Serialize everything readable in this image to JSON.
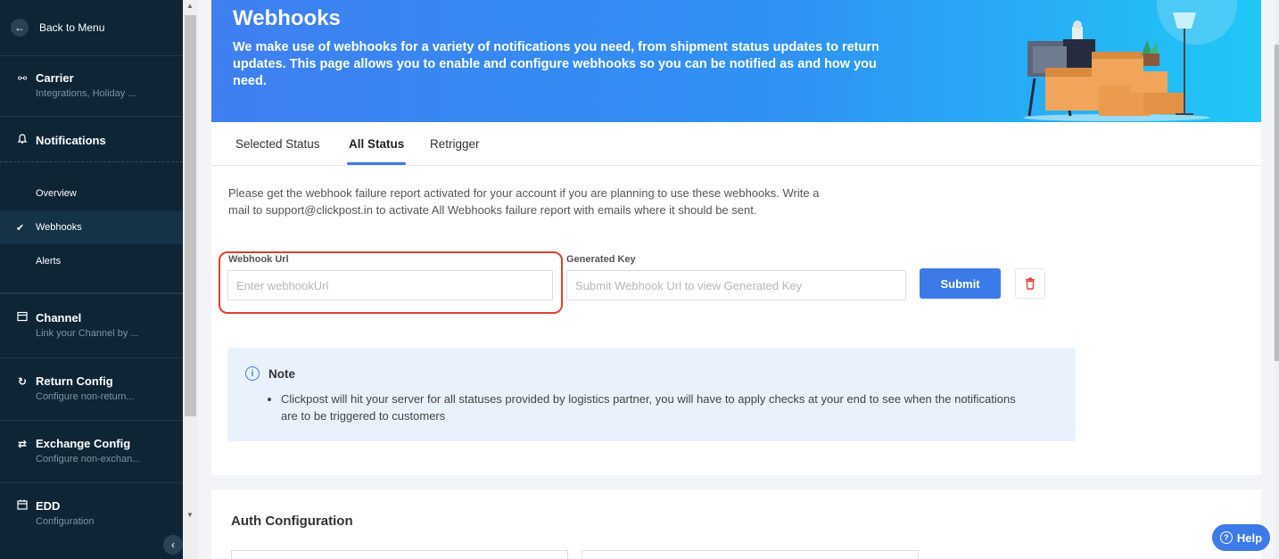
{
  "sidebar": {
    "back_label": "Back to Menu",
    "sections": {
      "carrier": {
        "title": "Carrier",
        "subtitle": "Integrations, Holiday ..."
      },
      "notifications": {
        "title": "Notifications"
      },
      "channel": {
        "title": "Channel",
        "subtitle": "Link your Channel by ..."
      },
      "return_config": {
        "title": "Return Config",
        "subtitle": "Configure non-return..."
      },
      "exchange_config": {
        "title": "Exchange Config",
        "subtitle": "Configure non-exchan..."
      },
      "edd": {
        "title": "EDD",
        "subtitle": "Configuration"
      }
    },
    "notification_items": [
      {
        "label": "Overview"
      },
      {
        "label": "Webhooks",
        "active": true
      },
      {
        "label": "Alerts"
      }
    ]
  },
  "hero": {
    "title": "Webhooks",
    "description": "We make use of webhooks for a variety of notifications you need, from shipment status updates to return updates. This page allows you to enable and configure webhooks so you can be notified as and how you need."
  },
  "tabs": [
    {
      "label": "Selected Status"
    },
    {
      "label": "All Status",
      "active": true
    },
    {
      "label": "Retrigger"
    }
  ],
  "info_text": "Please get the webhook failure report activated for your account if you are planning to use these webhooks. Write a mail to support@clickpost.in to activate All Webhooks failure report with emails where it should be sent.",
  "form": {
    "webhook_url_label": "Webhook Url",
    "webhook_url_placeholder": "Enter webhookUrl",
    "webhook_url_value": "",
    "generated_key_label": "Generated Key",
    "generated_key_placeholder": "Submit Webhook Url to view Generated Key",
    "submit_label": "Submit"
  },
  "note": {
    "title": "Note",
    "items": [
      "Clickpost will hit your server for all statuses provided by logistics partner, you will have to apply checks at your end to see when the notifications are to be triggered to customers"
    ]
  },
  "auth": {
    "title": "Auth Configuration"
  },
  "help_label": "Help",
  "colors": {
    "sidebar_bg": "#0e2536",
    "accent": "#3c7ae8",
    "highlight": "#d9452e",
    "note_bg": "#e9f1fd"
  }
}
